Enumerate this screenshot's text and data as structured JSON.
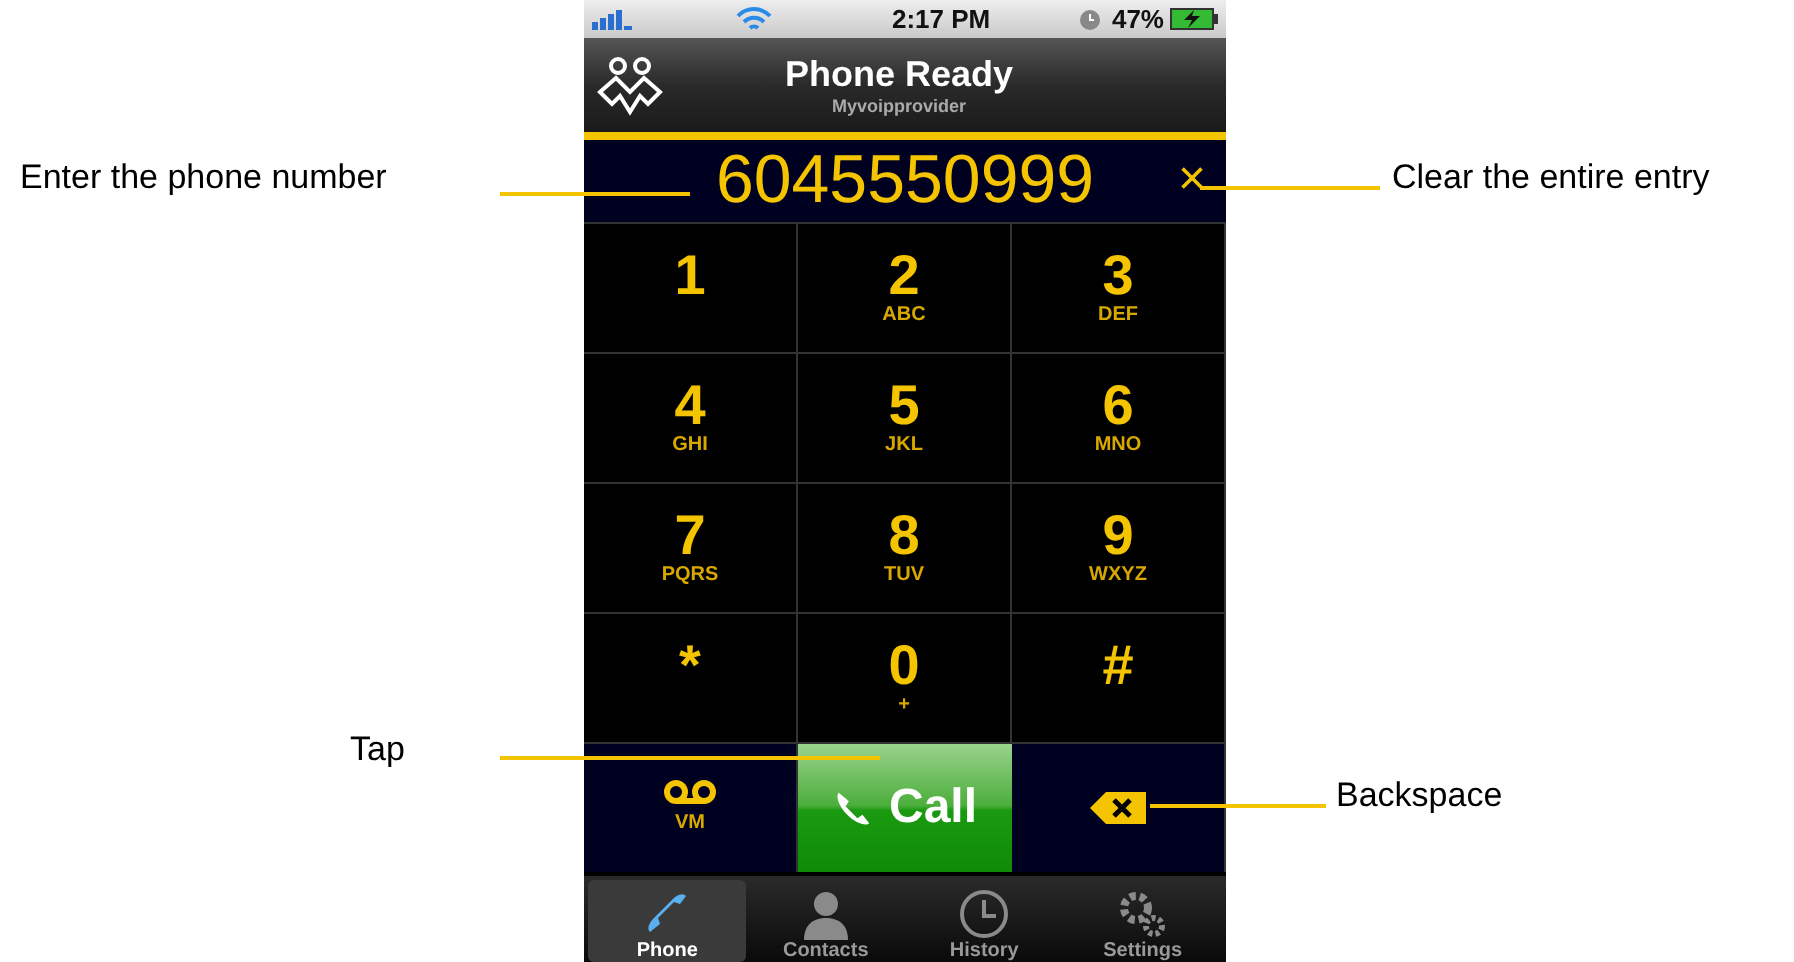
{
  "status_bar": {
    "time": "2:17 PM",
    "battery": "47%"
  },
  "title_bar": {
    "title": "Phone Ready",
    "subtitle": "Myvoipprovider"
  },
  "display": {
    "number": "6045550999",
    "clear": "×"
  },
  "keypad": [
    {
      "digit": "1"
    },
    {
      "digit": "2",
      "letters": "ABC"
    },
    {
      "digit": "3",
      "letters": "DEF"
    },
    {
      "digit": "4",
      "letters": "GHI"
    },
    {
      "digit": "5",
      "letters": "JKL"
    },
    {
      "digit": "6",
      "letters": "MNO"
    },
    {
      "digit": "7",
      "letters": "PQRS"
    },
    {
      "digit": "8",
      "letters": "TUV"
    },
    {
      "digit": "9",
      "letters": "WXYZ"
    },
    {
      "digit": "*"
    },
    {
      "digit": "0",
      "letters": "+"
    },
    {
      "digit": "#"
    }
  ],
  "actions": {
    "voicemail": "VM",
    "call": "Call"
  },
  "tabs": [
    {
      "label": "Phone",
      "kind": "phone",
      "selected": true
    },
    {
      "label": "Contacts",
      "kind": "contacts",
      "selected": false
    },
    {
      "label": "History",
      "kind": "history",
      "selected": false
    },
    {
      "label": "Settings",
      "kind": "settings",
      "selected": false
    }
  ],
  "callouts": [
    {
      "text": "Enter the phone number",
      "kind": "number"
    },
    {
      "text": "Clear the entire entry",
      "kind": "clear"
    },
    {
      "text": "Tap",
      "kind": "call"
    },
    {
      "text": "Backspace",
      "kind": "backspace"
    }
  ]
}
